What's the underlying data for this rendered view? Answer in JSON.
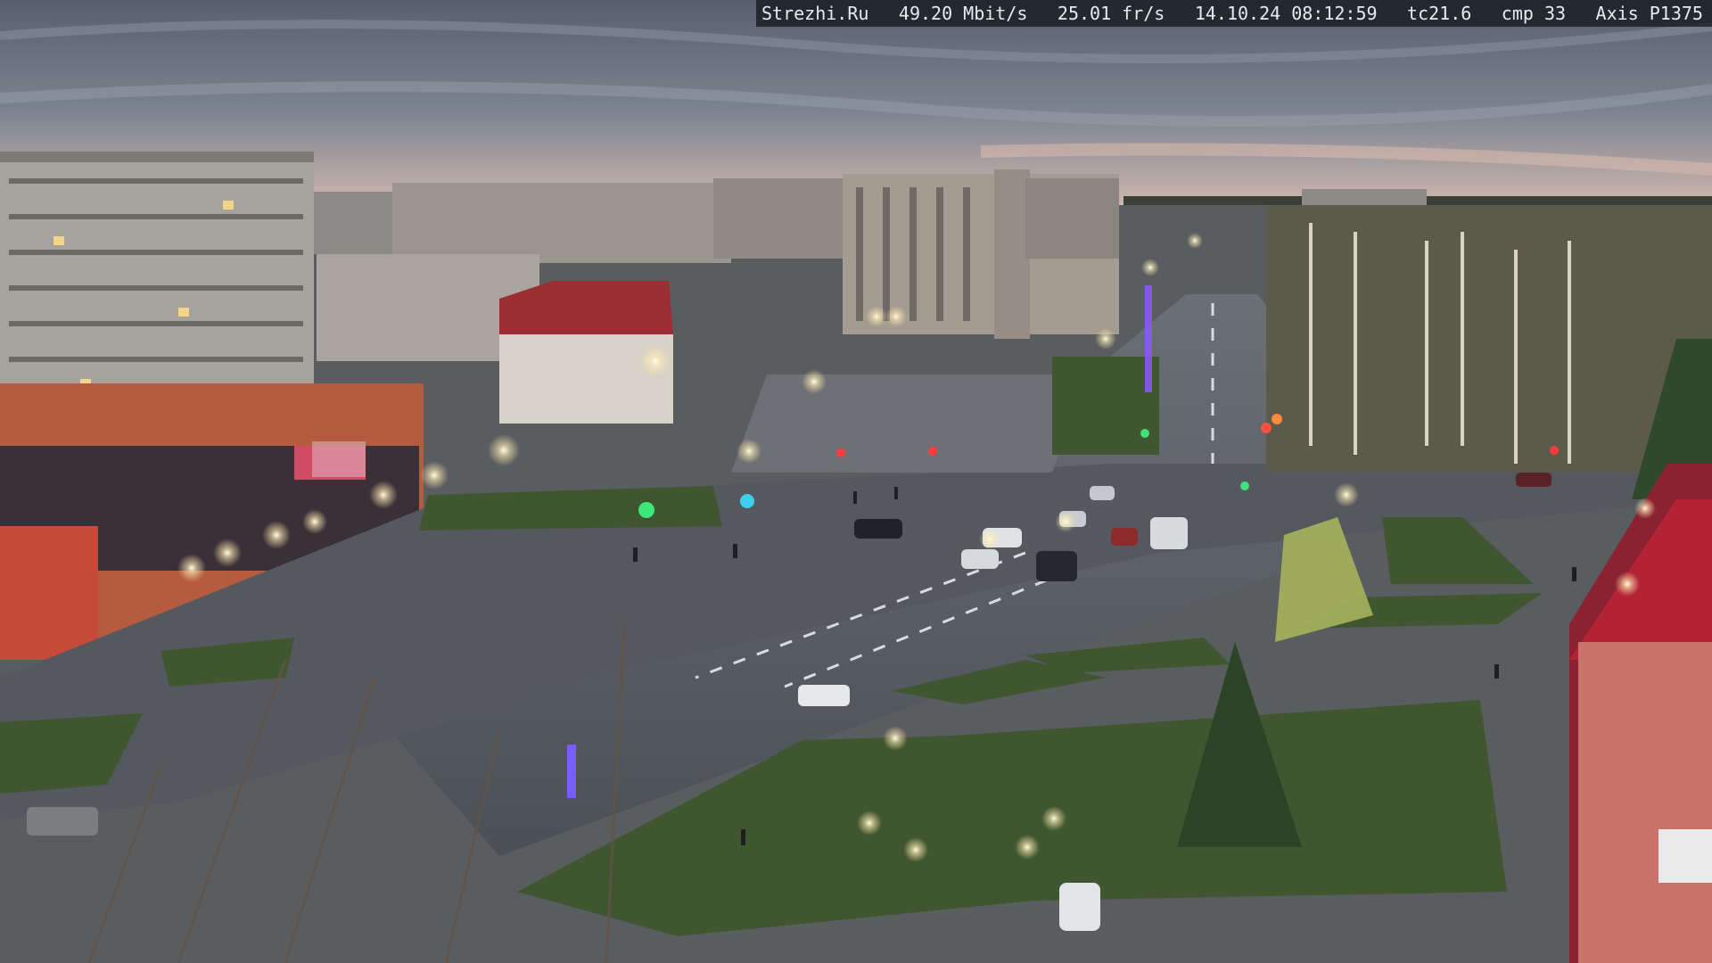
{
  "overlay": {
    "site": "Strezhi.Ru",
    "bitrate": "49.20 Mbit/s",
    "framerate": "25.01 fr/s",
    "datetime": "14.10.24 08:12:59",
    "tc": "tc21.6",
    "cmp": "cmp 33",
    "camera": "Axis P1375"
  },
  "colors": {
    "sky_top": "#5b6678",
    "sky_horizon": "#c9b7b0",
    "road": "#4a4e55",
    "grass": "#3f5a33",
    "brick": "#b8563e",
    "roof_red": "#b22a36",
    "lamp": "#fff6d8"
  }
}
